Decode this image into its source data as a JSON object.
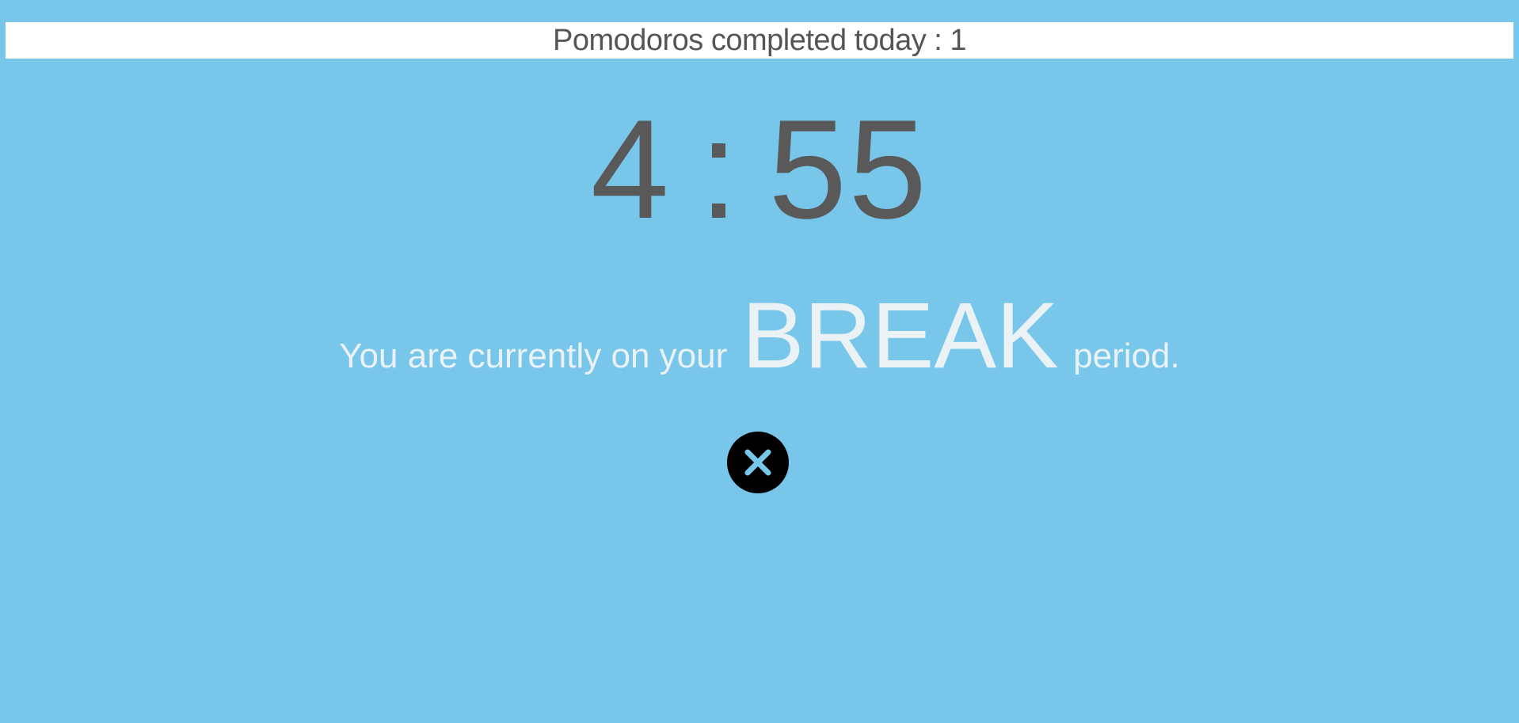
{
  "header": {
    "pomodoros_label": "Pomodoros completed today : 1"
  },
  "timer": {
    "minutes": "4",
    "separator": ":",
    "seconds": "55"
  },
  "status": {
    "prefix": "You are currently on your",
    "mode": "BREAK",
    "suffix": "period."
  },
  "icons": {
    "close": "close-icon"
  },
  "colors": {
    "background": "#79c6eb",
    "timer_text": "#595959",
    "status_text": "#eaf2f6",
    "header_bg": "#ffffff",
    "close_button_bg": "#000000",
    "close_icon": "#79c6eb"
  }
}
